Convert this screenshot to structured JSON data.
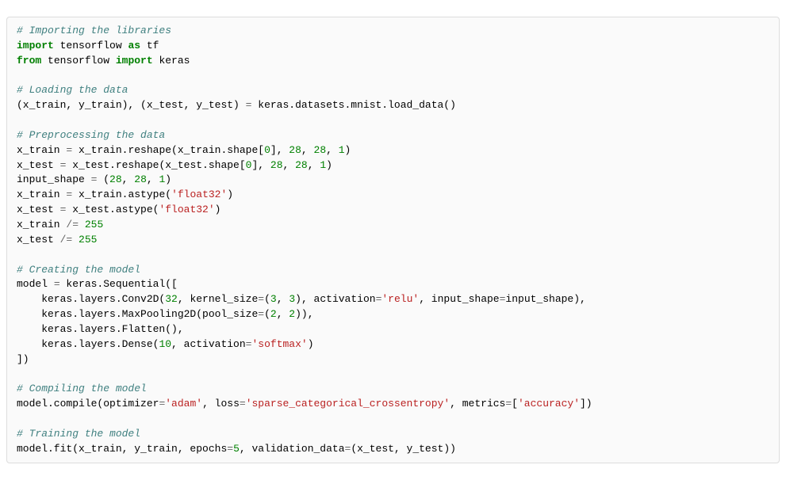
{
  "code": {
    "lines": [
      {
        "t": "comment",
        "text": "# Importing the libraries"
      },
      {
        "t": "import_as",
        "kw1": "import",
        "mod": "tensorflow",
        "kw2": "as",
        "alias": "tf"
      },
      {
        "t": "from_import",
        "kw1": "from",
        "mod": "tensorflow",
        "kw2": "import",
        "name": "keras"
      },
      {
        "t": "blank"
      },
      {
        "t": "comment",
        "text": "# Loading the data"
      },
      {
        "t": "load_data",
        "pre": "(x_train, y_train), (x_test, y_test) ",
        "op": "=",
        "post": " keras.datasets.mnist.load_data()"
      },
      {
        "t": "blank"
      },
      {
        "t": "comment",
        "text": "# Preprocessing the data"
      },
      {
        "t": "reshape",
        "lhs": "x_train ",
        "op": "=",
        "mid1": " x_train.reshape(x_train.shape[",
        "n0": "0",
        "mid2": "], ",
        "n1": "28",
        "c1": ", ",
        "n2": "28",
        "c2": ", ",
        "n3": "1",
        "end": ")"
      },
      {
        "t": "reshape",
        "lhs": "x_test ",
        "op": "=",
        "mid1": " x_test.reshape(x_test.shape[",
        "n0": "0",
        "mid2": "], ",
        "n1": "28",
        "c1": ", ",
        "n2": "28",
        "c2": ", ",
        "n3": "1",
        "end": ")"
      },
      {
        "t": "tuple3",
        "lhs": "input_shape ",
        "op": "=",
        "mid": " (",
        "n1": "28",
        "c1": ", ",
        "n2": "28",
        "c2": ", ",
        "n3": "1",
        "end": ")"
      },
      {
        "t": "astype",
        "lhs": "x_train ",
        "op": "=",
        "mid": " x_train.astype(",
        "s": "'float32'",
        "end": ")"
      },
      {
        "t": "astype",
        "lhs": "x_test ",
        "op": "=",
        "mid": " x_test.astype(",
        "s": "'float32'",
        "end": ")"
      },
      {
        "t": "aug",
        "lhs": "x_train ",
        "op": "/=",
        "sp": " ",
        "n": "255"
      },
      {
        "t": "aug",
        "lhs": "x_test ",
        "op": "/=",
        "sp": " ",
        "n": "255"
      },
      {
        "t": "blank"
      },
      {
        "t": "comment",
        "text": "# Creating the model"
      },
      {
        "t": "seq_open",
        "lhs": "model ",
        "op": "=",
        "post": " keras.Sequential(["
      },
      {
        "t": "conv2d",
        "indent": "    ",
        "pre": "keras.layers.Conv2D(",
        "n0": "32",
        "mid1": ", kernel_size",
        "op1": "=",
        "p1": "(",
        "n1": "3",
        "c1": ", ",
        "n2": "3",
        "p2": ")",
        "mid2": ", activation",
        "op2": "=",
        "s1": "'relu'",
        "mid3": ", input_shape",
        "op3": "=",
        "post": "input_shape),"
      },
      {
        "t": "maxpool",
        "indent": "    ",
        "pre": "keras.layers.MaxPooling2D(pool_size",
        "op": "=",
        "p1": "(",
        "n1": "2",
        "c1": ", ",
        "n2": "2",
        "end": ")),"
      },
      {
        "t": "plain",
        "indent": "    ",
        "text": "keras.layers.Flatten(),"
      },
      {
        "t": "dense",
        "indent": "    ",
        "pre": "keras.layers.Dense(",
        "n": "10",
        "mid": ", activation",
        "op": "=",
        "s": "'softmax'",
        "end": ")"
      },
      {
        "t": "plain",
        "indent": "",
        "text": "])"
      },
      {
        "t": "blank"
      },
      {
        "t": "comment",
        "text": "# Compiling the model"
      },
      {
        "t": "compile",
        "pre": "model.compile(optimizer",
        "op1": "=",
        "s1": "'adam'",
        "mid1": ", loss",
        "op2": "=",
        "s2": "'sparse_categorical_crossentropy'",
        "mid2": ", metrics",
        "op3": "=",
        "br1": "[",
        "s3": "'accuracy'",
        "end": "])"
      },
      {
        "t": "blank"
      },
      {
        "t": "comment",
        "text": "# Training the model"
      },
      {
        "t": "fit",
        "pre": "model.fit(x_train, y_train, epochs",
        "op1": "=",
        "n": "5",
        "mid": ", validation_data",
        "op2": "=",
        "post": "(x_test, y_test))"
      }
    ]
  }
}
